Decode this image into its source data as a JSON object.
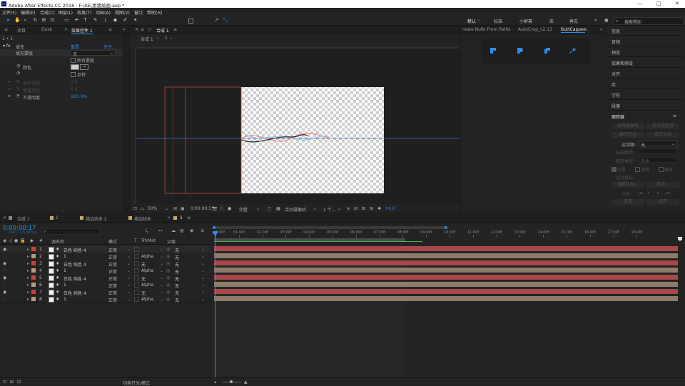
{
  "titlebar": {
    "title": "Adobe After Effects CC 2018 - F:\\AE\\黑猪绘画.aep *",
    "logo": "Ae",
    "minimize": "—",
    "maximize": "□",
    "close": "✕"
  },
  "menu": [
    "文件(F)",
    "编辑(E)",
    "合成(C)",
    "图层(L)",
    "效果(T)",
    "动画(A)",
    "视图(V)",
    "窗口",
    "帮助(H)"
  ],
  "workspaces": [
    "默认",
    "标准",
    "小屏幕",
    "库",
    "再见"
  ],
  "search_placeholder": "搜索帮助",
  "effects_panel": {
    "tabs": [
      "项目",
      "Dusk",
      "效果控件 1"
    ],
    "crumb": "1 • 1",
    "effect_name": "填充",
    "reset": "重置",
    "about": "关于...",
    "rows": [
      {
        "label": "填充蒙版",
        "value": "无"
      },
      {
        "label": "",
        "value": "所有蒙版"
      },
      {
        "label": "颜色",
        "value": ""
      },
      {
        "label": "",
        "value": "反转"
      },
      {
        "label": "水平羽化",
        "value": "0.0"
      },
      {
        "label": "垂直羽化",
        "value": "0.0"
      },
      {
        "label": "不透明度",
        "value": "100.0%"
      }
    ]
  },
  "composition": {
    "tab": "合成 1",
    "sub": [
      "合成 1",
      "1"
    ],
    "zoom": "50%",
    "timecode": "0:00:00:17",
    "quality": "完整",
    "camera": "活动摄像机",
    "views": "1 个...",
    "exposure": "+0.0"
  },
  "scripts": {
    "tabs": [
      "reate Nulls From Paths",
      "AutoCrop_v2.13",
      "ButtCapper"
    ],
    "icons": [
      "butt-cap-icon",
      "round-cap-icon",
      "square-cap-icon",
      "wrench-icon"
    ]
  },
  "right_panel": {
    "items": [
      "信息",
      "音频",
      "预览",
      "效果和预设",
      "对齐",
      "库",
      "字符",
      "段落"
    ],
    "tracker": {
      "title": "跟踪器",
      "buttons": [
        "跟踪摄像机",
        "变形稳定器",
        "跟踪运动",
        "稳定运动"
      ],
      "source_label": "运动源:",
      "source_value": "无",
      "current_label": "当前跟踪:",
      "type_label": "跟踪类型:",
      "type_value": "变换",
      "checks": [
        "位置",
        "旋转",
        "缩放"
      ],
      "motion_target": "运动目标:",
      "edit_target": "编辑目标...",
      "options": "选项...",
      "analyze": "分析:",
      "reset": "重置",
      "apply": "应用"
    }
  },
  "timeline": {
    "tabs": [
      "合成 1",
      "1",
      "描边线条 2",
      "描边线条",
      "1"
    ],
    "timecode": "0:00:00:17",
    "fps": "00017 (25.00 fps)",
    "columns": {
      "name": "源名称",
      "mode": "模式",
      "t": "T",
      "trkmat": "TrkMat",
      "parent": "父级"
    },
    "ticks": [
      "0:00f",
      "01:00f",
      "02:00f",
      "03:00f",
      "04:00f",
      "05:00f",
      "06:00f",
      "07:00f",
      "08:00f",
      "09:00f",
      "10:00f",
      "11:00f",
      "12:00f",
      "13:00f",
      "14:00f",
      "15:00f",
      "16:00f",
      "17:00f",
      "18:00f"
    ],
    "layers": [
      {
        "num": "1",
        "name": "白色 纯色 4",
        "mode": "正常",
        "trk": "",
        "parent": "无",
        "color": "#c9413d",
        "bar": "#a8474a",
        "eye": true
      },
      {
        "num": "2",
        "name": "1",
        "mode": "正常",
        "trk": "Alpha",
        "parent": "无",
        "color": "#b59a7c",
        "bar": "#8d7c6a",
        "eye": false
      },
      {
        "num": "3",
        "name": "白色 纯色 4",
        "mode": "正常",
        "trk": "无",
        "parent": "无",
        "color": "#c9413d",
        "bar": "#a8474a",
        "eye": true
      },
      {
        "num": "4",
        "name": "1",
        "mode": "正常",
        "trk": "Alpha",
        "parent": "无",
        "color": "#b59a7c",
        "bar": "#8d7c6a",
        "eye": false
      },
      {
        "num": "5",
        "name": "白色 纯色 4",
        "mode": "正常",
        "trk": "无",
        "parent": "无",
        "color": "#c9413d",
        "bar": "#a8474a",
        "eye": true
      },
      {
        "num": "6",
        "name": "1",
        "mode": "正常",
        "trk": "Alpha",
        "parent": "无",
        "color": "#b59a7c",
        "bar": "#8d7c6a",
        "eye": false
      },
      {
        "num": "7",
        "name": "白色 纯色 4",
        "mode": "正常",
        "trk": "无",
        "parent": "无",
        "color": "#c9413d",
        "bar": "#a8474a",
        "eye": true
      },
      {
        "num": "8",
        "name": "1",
        "mode": "正常",
        "trk": "Alpha",
        "parent": "无",
        "color": "#b59a7c",
        "bar": "#8d7c6a",
        "eye": false
      }
    ],
    "footer_toggle": "切换开关/模式"
  },
  "colors": {
    "accent": "#2d8ceb",
    "bg": "#1d1d1d",
    "panel": "#232323"
  }
}
